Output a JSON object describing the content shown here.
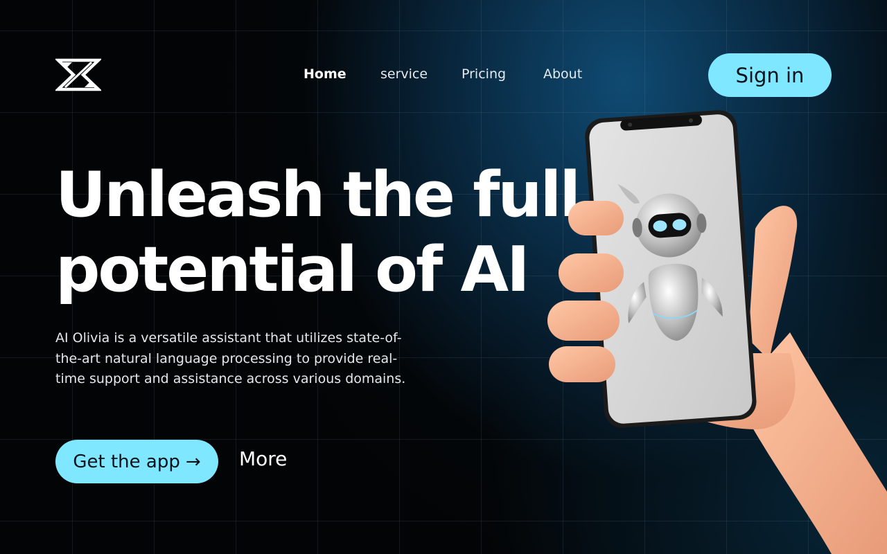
{
  "brand": {
    "logo_icon": "x-arrows-logo-icon"
  },
  "nav": {
    "items": [
      {
        "label": "Home",
        "active": true
      },
      {
        "label": "service",
        "active": false
      },
      {
        "label": "Pricing",
        "active": false
      },
      {
        "label": "About",
        "active": false
      }
    ]
  },
  "header": {
    "signin_label": "Sign in"
  },
  "hero": {
    "headline_line1": "Unleash the full",
    "headline_line2": "potential of AI",
    "description_lines": [
      "AI Olivia is a versatile assistant that utilizes state-of-",
      "the-art natural language processing to provide real-",
      "time support and assistance across various domains."
    ],
    "cta_label": "Get the app",
    "cta_icon": "arrow-right-icon",
    "cta_arrow": "→",
    "more_label": "More"
  },
  "illustration": {
    "subject": "hand-holding-phone-with-robot"
  },
  "colors": {
    "accent": "#7fe7ff",
    "background": "#030507",
    "glow": "#0f4a72"
  }
}
